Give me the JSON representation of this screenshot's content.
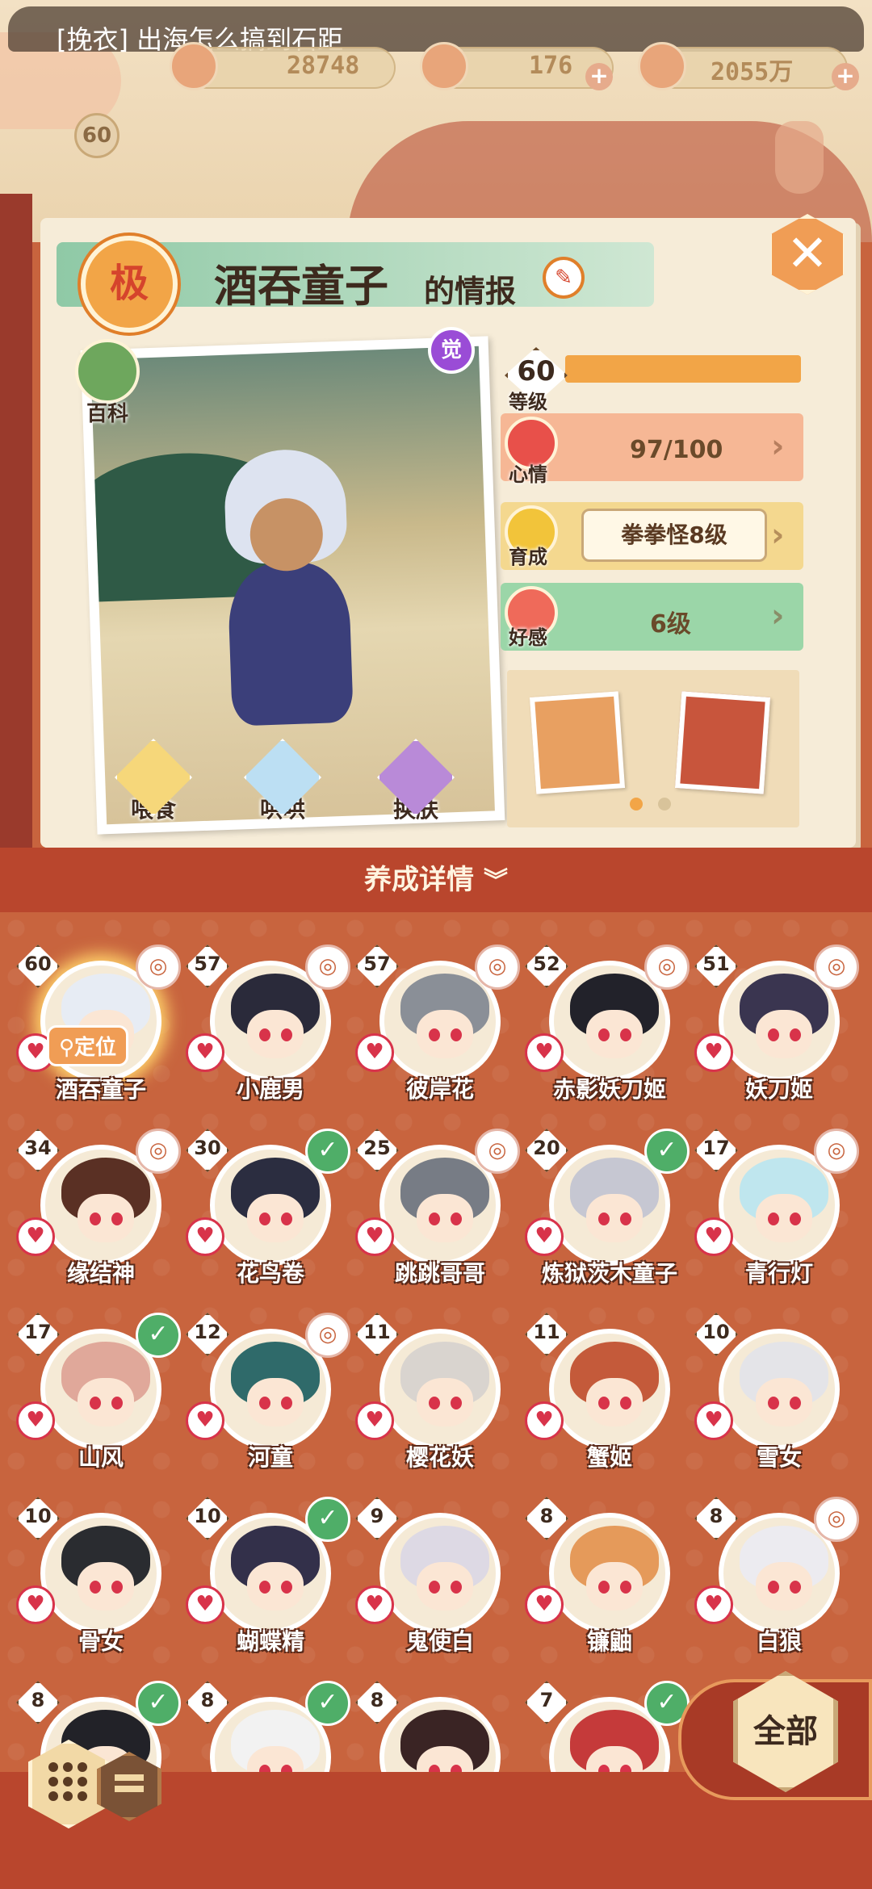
{
  "header": {
    "notice": "[挽衣] 出海怎么搞到石距",
    "resources": [
      {
        "icon": "jade-icon",
        "value": "28748"
      },
      {
        "icon": "stamina-icon",
        "value": "176"
      },
      {
        "icon": "coin-icon",
        "value": "2055万"
      }
    ],
    "player_level": "60"
  },
  "info_panel": {
    "rank_badge": "极",
    "name": "酒吞童子",
    "title_suffix": "的情报",
    "awaken_badge": "觉",
    "encyclopedia_label": "百科",
    "actions": [
      "喂食",
      "哄哄",
      "换肤"
    ],
    "level": {
      "value": "60",
      "label": "等级",
      "fill": 1.0
    },
    "mood": {
      "label": "心情",
      "value": "97/100"
    },
    "growth": {
      "label": "育成",
      "value": "拳拳怪8级"
    },
    "affection": {
      "label": "好感",
      "value": "6级"
    },
    "page_dots": 2,
    "active_dot": 0
  },
  "details_label": "养成详情",
  "locate_label": "定位",
  "characters": [
    {
      "level": "60",
      "name": "酒吞童子",
      "mark": "icon",
      "selected": true,
      "hair": "#e7ecf4"
    },
    {
      "level": "57",
      "name": "小鹿男",
      "mark": "icon",
      "hair": "#2a2a3a"
    },
    {
      "level": "57",
      "name": "彼岸花",
      "mark": "icon",
      "hair": "#8a8f97"
    },
    {
      "level": "52",
      "name": "赤影妖刀姬",
      "mark": "icon",
      "hair": "#22222a"
    },
    {
      "level": "51",
      "name": "妖刀姬",
      "mark": "icon",
      "hair": "#3a3550"
    },
    {
      "level": "34",
      "name": "缘结神",
      "mark": "icon",
      "hair": "#5a3024"
    },
    {
      "level": "30",
      "name": "花鸟卷",
      "mark": "check",
      "hair": "#2b2d40"
    },
    {
      "level": "25",
      "name": "跳跳哥哥",
      "mark": "icon",
      "hair": "#777c85"
    },
    {
      "level": "20",
      "name": "炼狱茨木童子",
      "mark": "check",
      "hair": "#c6c7d2"
    },
    {
      "level": "17",
      "name": "青行灯",
      "mark": "icon",
      "hair": "#bfe6ee"
    },
    {
      "level": "17",
      "name": "山风",
      "mark": "check",
      "hair": "#e0a89a"
    },
    {
      "level": "12",
      "name": "河童",
      "mark": "icon",
      "hair": "#2f6a6a"
    },
    {
      "level": "11",
      "name": "樱花妖",
      "mark": "none",
      "hair": "#d9d4cf"
    },
    {
      "level": "11",
      "name": "蟹姬",
      "mark": "none",
      "hair": "#c45a3a"
    },
    {
      "level": "10",
      "name": "雪女",
      "mark": "none",
      "hair": "#e4e4e8"
    },
    {
      "level": "10",
      "name": "骨女",
      "mark": "none",
      "hair": "#2a2c30"
    },
    {
      "level": "10",
      "name": "蝴蝶精",
      "mark": "check",
      "hair": "#33304a"
    },
    {
      "level": "9",
      "name": "鬼使白",
      "mark": "none",
      "hair": "#ddd9e4"
    },
    {
      "level": "8",
      "name": "镰鼬",
      "mark": "none",
      "hair": "#e59a5a"
    },
    {
      "level": "8",
      "name": "白狼",
      "mark": "icon",
      "hair": "#ecebf0"
    },
    {
      "level": "8",
      "name": "",
      "mark": "check",
      "hair": "#222228"
    },
    {
      "level": "8",
      "name": "",
      "mark": "check",
      "hair": "#f2f2f2"
    },
    {
      "level": "8",
      "name": "",
      "mark": "none",
      "hair": "#3a2424"
    },
    {
      "level": "7",
      "name": "",
      "mark": "check",
      "hair": "#c53a3a"
    }
  ],
  "filter_label": "全部",
  "colors": {
    "mood_row": "#f6b795",
    "growth_row": "#f4d88f",
    "affection_row": "#9bd6a8",
    "check_green": "#4fae68"
  }
}
